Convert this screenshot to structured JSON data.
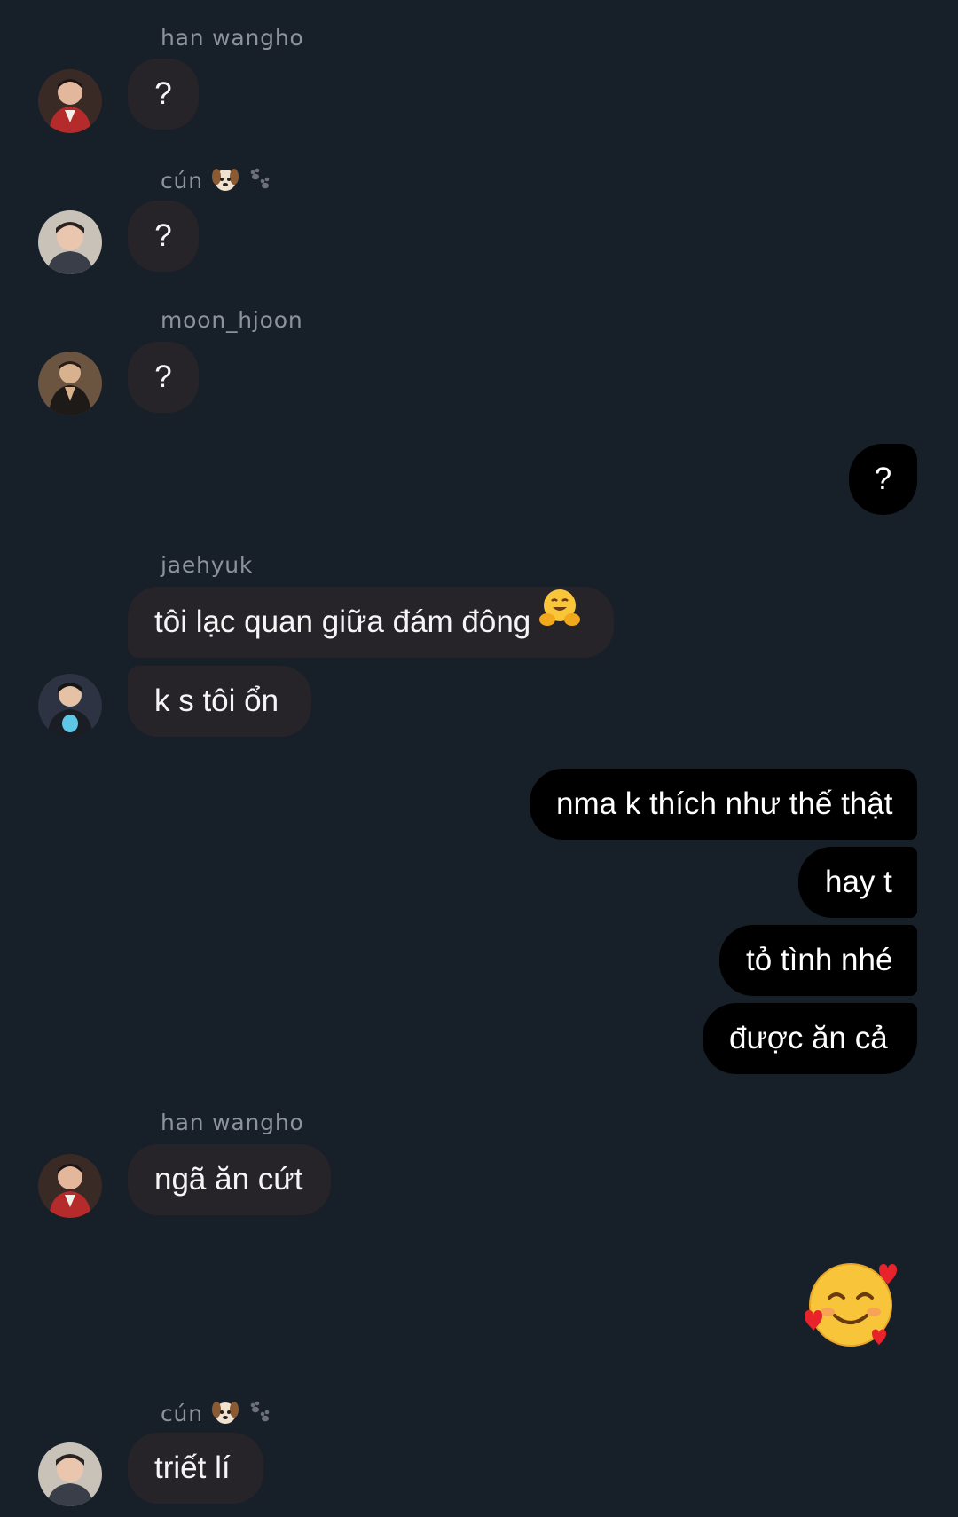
{
  "messages": {
    "m1": {
      "sender": "han wangho",
      "text": "?"
    },
    "m2": {
      "sender": "cún",
      "text": "?"
    },
    "m3": {
      "sender": "moon_hjoon",
      "text": "?"
    },
    "m4": {
      "text": "?"
    },
    "m5": {
      "sender": "jaehyuk",
      "line1": "tôi lạc quan giữa đám đông",
      "line2": "k s tôi ổn"
    },
    "m6": {
      "lines": [
        "nma k thích như thế thật",
        "hay t",
        "tỏ tình nhé",
        "được ăn cả"
      ]
    },
    "m7": {
      "sender": "han wangho",
      "text": "ngã ăn cứt"
    },
    "m9": {
      "sender": "cún",
      "text": "triết lí"
    }
  },
  "icons": {
    "sender_decoration": [
      "dog-face-icon",
      "paw-prints-icon"
    ],
    "inline_emoji": "hugging-face-icon",
    "reaction_emoji": "smiling-face-with-hearts-icon"
  },
  "colors": {
    "background": "#171f29",
    "incoming_bubble": "#262329",
    "outgoing_bubble": "#000000",
    "sender_name": "#8d939b"
  }
}
